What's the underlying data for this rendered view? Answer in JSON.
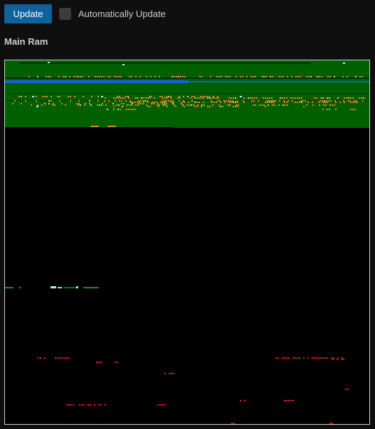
{
  "toolbar": {
    "update_label": "Update",
    "auto_update_label": "Automatically Update",
    "auto_update_checked": false
  },
  "section": {
    "title": "Main Ram"
  },
  "colors": {
    "background": "#0f0f0f",
    "button": "#0e639c",
    "ram_green": "#006000",
    "ram_blue": "#1a5fd6",
    "ram_orange": "#e08a2a",
    "ram_red": "#e02020",
    "ram_cyan": "#9ff5f0"
  }
}
